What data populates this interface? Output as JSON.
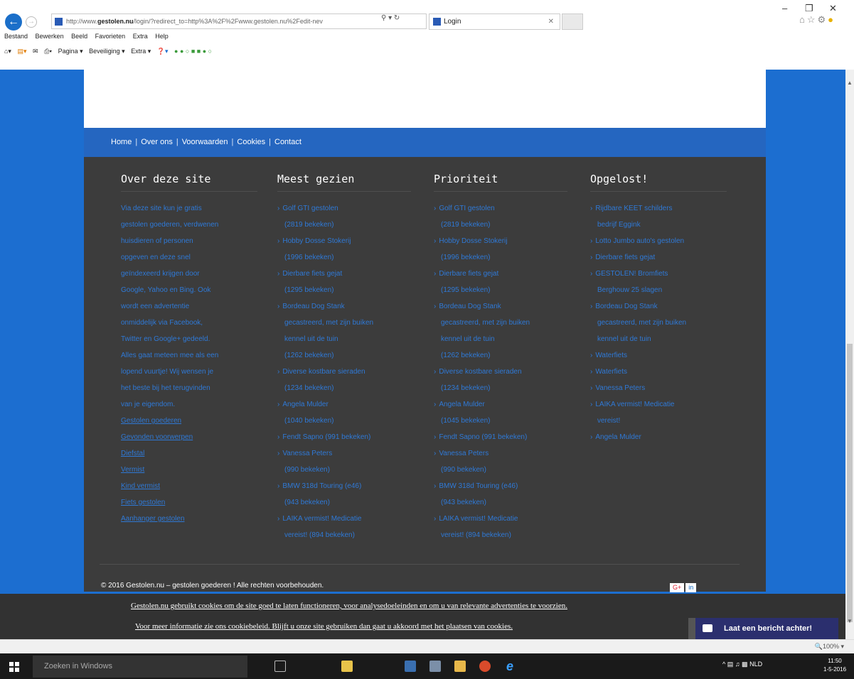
{
  "browser": {
    "address_prefix": "http://www.",
    "address_domain": "gestolen.nu",
    "address_rest": "/login/?redirect_to=http%3A%2F%2Fwww.gestolen.nu%2Fedit-nev",
    "tab_title": "Login",
    "menu": [
      "Bestand",
      "Bewerken",
      "Beeld",
      "Favorieten",
      "Extra",
      "Help"
    ],
    "commands": [
      "Pagina ▾",
      "Beveiliging ▾",
      "Extra ▾"
    ],
    "zoom": "100%"
  },
  "nav": {
    "items": [
      "Home",
      "Over ons",
      "Voorwaarden",
      "Cookies",
      "Contact"
    ]
  },
  "footer": {
    "about": {
      "title": "Over deze site",
      "lines": [
        "Via deze site kun je gratis",
        "gestolen goederen, verdwenen",
        "huisdieren of personen",
        "opgeven en deze snel",
        "geïndexeerd krijgen door",
        "Google, Yahoo en Bing. Ook",
        "wordt een advertentie",
        "onmiddelijk via Facebook,",
        "Twitter en Google+ gedeeld.",
        "Alles gaat meteen mee als een",
        "lopend vuurtje! Wij wensen je",
        "het beste bij het terugvinden",
        "van je eigendom."
      ],
      "links": [
        "Gestolen goederen",
        "Gevonden voorwerpen",
        "Diefstal",
        "Vermist",
        "Kind vermist",
        "Fiets gestolen",
        "Aanhanger gestolen"
      ]
    },
    "most_viewed": {
      "title": "Meest gezien",
      "items": [
        [
          "Golf GTI gestolen",
          "(2819 bekeken)"
        ],
        [
          "Hobby Dosse Stokerij",
          "(1996 bekeken)"
        ],
        [
          "Dierbare fiets gejat",
          "(1295 bekeken)"
        ],
        [
          "Bordeau Dog Stank",
          "gecastreerd, met zijn buiken",
          "kennel uit de tuin",
          "(1262 bekeken)"
        ],
        [
          "Diverse kostbare sieraden",
          "(1234 bekeken)"
        ],
        [
          "Angela Mulder",
          "(1040 bekeken)"
        ],
        [
          "Fendt Sapno (991 bekeken)"
        ],
        [
          "Vanessa Peters",
          "(990 bekeken)"
        ],
        [
          "BMW 318d Touring (e46)",
          "(943 bekeken)"
        ],
        [
          "LAIKA vermist! Medicatie",
          "vereist! (894 bekeken)"
        ]
      ]
    },
    "priority": {
      "title": "Prioriteit",
      "items": [
        [
          "Golf GTI gestolen",
          "(2819 bekeken)"
        ],
        [
          "Hobby Dosse Stokerij",
          "(1996 bekeken)"
        ],
        [
          "Dierbare fiets gejat",
          "(1295 bekeken)"
        ],
        [
          "Bordeau Dog Stank",
          "gecastreerd, met zijn buiken",
          "kennel uit de tuin",
          "(1262 bekeken)"
        ],
        [
          "Diverse kostbare sieraden",
          "(1234 bekeken)"
        ],
        [
          "Angela Mulder",
          "(1045 bekeken)"
        ],
        [
          "Fendt Sapno (991 bekeken)"
        ],
        [
          "Vanessa Peters",
          "(990 bekeken)"
        ],
        [
          "BMW 318d Touring (e46)",
          "(943 bekeken)"
        ],
        [
          "LAIKA vermist! Medicatie",
          "vereist! (894 bekeken)"
        ]
      ]
    },
    "solved": {
      "title": "Opgelost!",
      "items": [
        [
          "Rijdbare KEET schilders",
          "bedrijf Eggink"
        ],
        [
          "Lotto Jumbo auto's gestolen"
        ],
        [
          "Dierbare fiets gejat"
        ],
        [
          "GESTOLEN! Bromfiets",
          "Berghouw 25 slagen"
        ],
        [
          "Bordeau Dog Stank",
          "gecastreerd, met zijn buiken",
          "kennel uit de tuin"
        ],
        [
          "Waterfiets"
        ],
        [
          "Waterfiets"
        ],
        [
          "Vanessa Peters"
        ],
        [
          "LAIKA vermist! Medicatie",
          "vereist!"
        ],
        [
          "Angela Mulder"
        ]
      ]
    },
    "copyright": "© 2016 Gestolen.nu – gestolen goederen ! Alle rechten voorbehouden.",
    "social": [
      "G+",
      "in"
    ]
  },
  "cookie": {
    "line1": "Gestolen.nu gebruikt cookies om de site goed te laten functioneren, voor analysedoeleinden en om u van relevante advertenties te voorzien.",
    "line2": "Voor meer informatie zie ons cookiebeleid. Blijft u onze site gebruiken dan gaat u akkoord met het plaatsen van cookies."
  },
  "chat": {
    "label": "Laat een bericht achter!"
  },
  "taskbar": {
    "search_placeholder": "Zoeken in Windows",
    "lang": "NLD",
    "time": "11:50",
    "date": "1-5-2016"
  },
  "colors": {
    "accent": "#1c6ed0",
    "nav": "#2566c0",
    "footer": "#3c3c3c",
    "link": "#2f79d6",
    "chat": "#2b2f6e"
  }
}
